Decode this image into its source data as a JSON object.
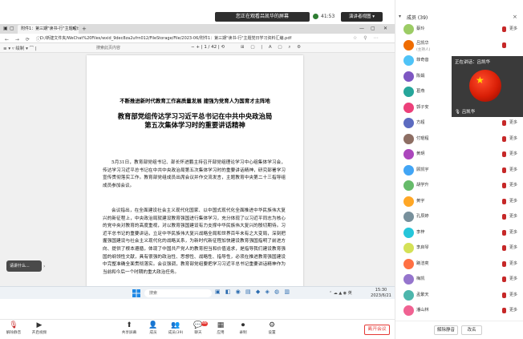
{
  "topbar": {
    "share_banner": "您正在观看吕凯华的屏幕",
    "timer": "41:53",
    "view_button": "演讲者视图 ▾"
  },
  "remote": {
    "browser_tab_title": "附件1：第三期\"读书-行\"主题理论...",
    "url": "D:/新建文件夹/WeChat%20Files/wxid_9dec8za2ufrn012/FileStorage/File/2023-06/附件1：第三期\"读书-行\"主题党日学习资料汇编.pdf",
    "toolbar_left": "≡ ▾  ▿ 绘制 ▾  ⌒  |",
    "pdf_search": "搜索此页内容",
    "page_indicator": "− + | 1  / 42 | ⟲",
    "toolbar_right": "⊞ ▢ | A ▢ ⌕ ⚙",
    "doc_header": "不断推进新时代教育工作高质量发展 建强为党育人为国育才主阵地",
    "doc_title_1": "教育部党组传达学习习近平总书记在中共中央政治局",
    "doc_title_2": "第五次集体学习时的重要讲话精神",
    "para_1": "5月31日，教育部党组书记、部长怀进鹏主持召开部党组理论学习中心组集体学习会，传达学习习近平总书记在中共中央政治局第五次集体学习时的重要讲话精神，研究部署学习宣传贯彻落实工作。教育部党组成员出席会议并作交流发言，主题教育中央第二十三指导组成员参加会议。",
    "para_2": "会议指出，在全面建设社会主义现代化国家、以中国式现代化全面推进中华民族伟大复兴的新征程上，中央政治局就建设教育强国进行集体学习，充分体现了以习近平同志为核心的党中央对教育的高度重视，对以教育强国建设有力支撑中华民族伟大复兴的殷切期待。习近平总书记的重要讲话，立足中华民族伟大复兴战略全局和世界百年未有之大变局，深刻把握强国建设与社会主义现代化的战略关系，为新时代新征程加快建设教育强国指明了前进方向、提供了根本遵循，体现了中国共产党人的教育担当和价值追求，是指导我们建设教育强国的纲领性文献，具有很强的政治性、思想性、战略性、指导性，必须在推进教育强国建设中完整准确全面贯彻落实。会议强调，教育部党组要把学习习近平总书记重要讲话精神作为当前和今后一个时期的重大政治任务。",
    "chat_toast": "请讲什么...",
    "taskbar_search": "搜索",
    "taskbar_tray": "⌃ ☁ ▲ ◉ 英",
    "taskbar_time": "15:30",
    "taskbar_date": "2023/6/21"
  },
  "speaker": {
    "speaking_label": "正在讲话：吕凯华",
    "name": "吕凯华"
  },
  "panel": {
    "title": "成员 (39)",
    "participants": [
      {
        "name": "蔡玲",
        "sub": "",
        "color": "#9ccc65",
        "ctrl": "更多"
      },
      {
        "name": "吕凯华",
        "sub": "(主持人)",
        "color": "#ef6c00",
        "ctrl": ""
      },
      {
        "name": "菲奇音",
        "sub": "",
        "color": "#4fc3f7",
        "ctrl": ""
      },
      {
        "name": "陈娟",
        "sub": "",
        "color": "#7e57c2",
        "ctrl": ""
      },
      {
        "name": "葛燕",
        "sub": "",
        "color": "#26a69a",
        "ctrl": ""
      },
      {
        "name": "郭子安",
        "sub": "",
        "color": "#ec407a",
        "ctrl": "更多"
      },
      {
        "name": "方超",
        "sub": "",
        "color": "#5c6bc0",
        "ctrl": "更多"
      },
      {
        "name": "付琨程",
        "sub": "",
        "color": "#8d6e63",
        "ctrl": "更多"
      },
      {
        "name": "黄玥",
        "sub": "",
        "color": "#ab47bc",
        "ctrl": "更多"
      },
      {
        "name": "顾凯宇",
        "sub": "",
        "color": "#42a5f5",
        "ctrl": "更多"
      },
      {
        "name": "胡学升",
        "sub": "",
        "color": "#66bb6a",
        "ctrl": "更多"
      },
      {
        "name": "黄宇",
        "sub": "",
        "color": "#ffa726",
        "ctrl": "更多"
      },
      {
        "name": "孔辰婷",
        "sub": "",
        "color": "#78909c",
        "ctrl": "更多"
      },
      {
        "name": "李梓",
        "sub": "",
        "color": "#26c6da",
        "ctrl": "更多"
      },
      {
        "name": "李启琴",
        "sub": "",
        "color": "#d4e157",
        "ctrl": "更多"
      },
      {
        "name": "路洁奕",
        "sub": "",
        "color": "#ff7043",
        "ctrl": "更多"
      },
      {
        "name": "梅凯",
        "sub": "",
        "color": "#9575cd",
        "ctrl": "更多"
      },
      {
        "name": "孟繁天",
        "sub": "",
        "color": "#4db6ac",
        "ctrl": "更多"
      },
      {
        "name": "潘山林",
        "sub": "",
        "color": "#f06292",
        "ctrl": "更多"
      }
    ],
    "mute_all": "解除静音",
    "rename": "改名"
  },
  "toolbar": {
    "mute": "解除静音",
    "video": "开启视频",
    "share": "共享屏幕",
    "participants": "成员",
    "people_count": "成员(39)",
    "chat": "聊天",
    "chat_badge": "88",
    "apps": "应用",
    "record": "录制",
    "more": "设置",
    "leave": "离开会议"
  }
}
